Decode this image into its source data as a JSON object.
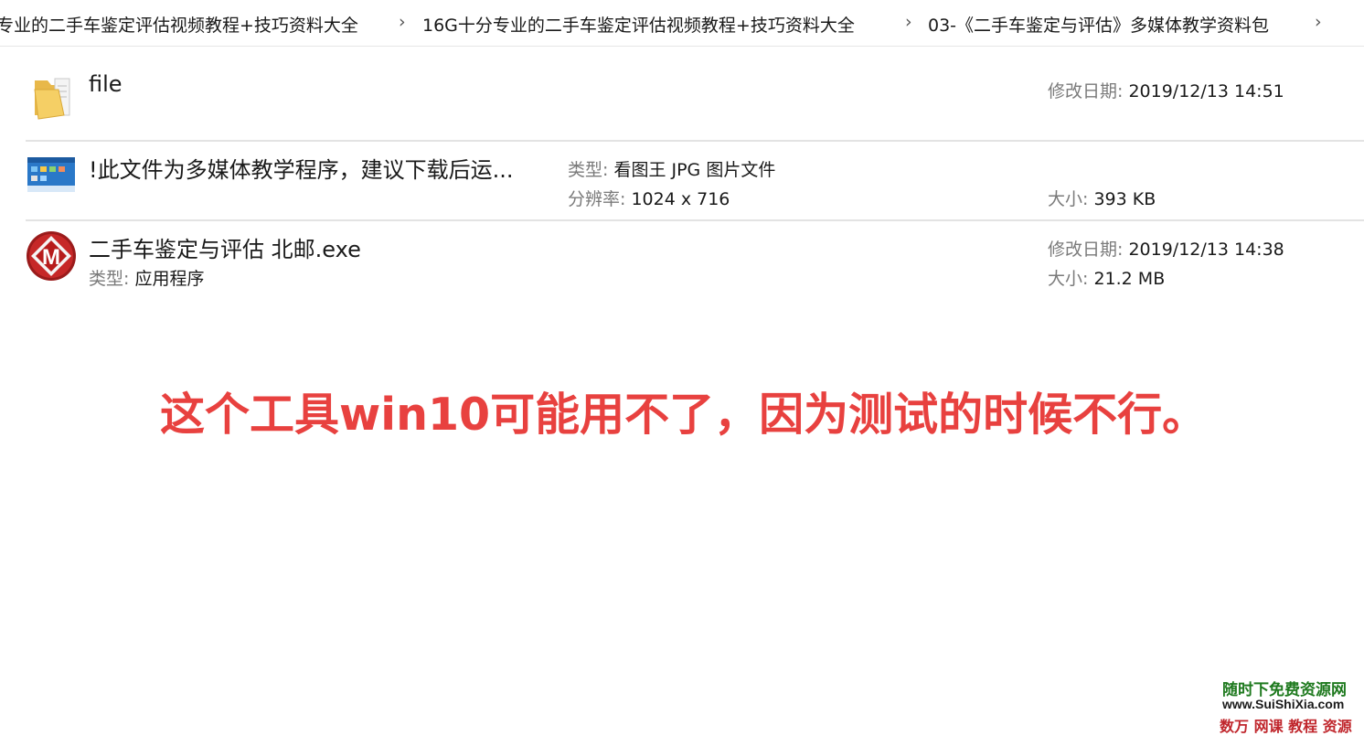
{
  "breadcrumb": {
    "items": [
      "专业的二手车鉴定评估视频教程+技巧资料大全",
      "16G十分专业的二手车鉴定评估视频教程+技巧资料大全",
      "03-《二手车鉴定与评估》多媒体教学资料包"
    ]
  },
  "files": [
    {
      "name": "file",
      "icon": "folder-icon",
      "modified_label": "修改日期:",
      "modified_value": "2019/12/13 14:51"
    },
    {
      "name": "!此文件为多媒体教学程序，建议下载后运...",
      "icon": "jpg-image-thumbnail",
      "type_label": "类型:",
      "type_value": "看图王 JPG 图片文件",
      "resolution_label": "分辨率:",
      "resolution_value": "1024 x 716",
      "size_label": "大小:",
      "size_value": "393 KB"
    },
    {
      "name": "二手车鉴定与评估 北邮.exe",
      "icon": "app-m-icon",
      "type_label": "类型:",
      "type_value": "应用程序",
      "modified_label": "修改日期:",
      "modified_value": "2019/12/13 14:38",
      "size_label": "大小:",
      "size_value": "21.2 MB"
    }
  ],
  "overlay_note": "这个工具win10可能用不了，因为测试的时候不行。",
  "watermark": {
    "line1": "随时下免费资源网",
    "line2": "www.SuiShiXia.com",
    "line3": "数万 网课 教程 资源"
  },
  "colors": {
    "note": "#e8413f",
    "watermark_green": "#1f7a1f",
    "watermark_red": "#c0262c"
  }
}
